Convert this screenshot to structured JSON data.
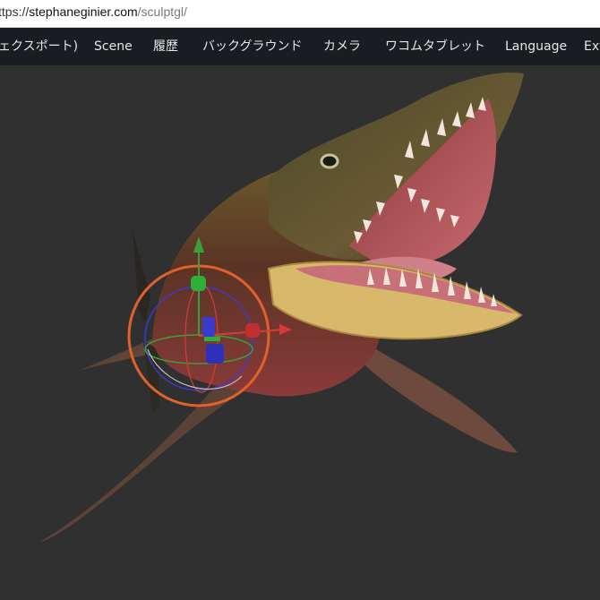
{
  "browser": {
    "url_prefix": "ttps://",
    "url_host": "stephaneginier.com",
    "url_path": "/sculptgl/"
  },
  "menu": {
    "items": [
      {
        "label": "ェクスポート)"
      },
      {
        "label": "Scene"
      },
      {
        "label": "履歴"
      },
      {
        "label": "バックグラウンド"
      },
      {
        "label": "カメラ"
      },
      {
        "label": "ワコムタブレット"
      },
      {
        "label": "Language"
      },
      {
        "label": "Ext"
      }
    ]
  },
  "viewport": {
    "background_color": "#303030",
    "model": "sea-reptile-creature",
    "gizmo": {
      "rotate_ring_color": "#e0622a",
      "x_axis_color": "#d83a3a",
      "y_axis_color": "#3aa03a",
      "z_axis_color": "#3a3acc"
    }
  }
}
